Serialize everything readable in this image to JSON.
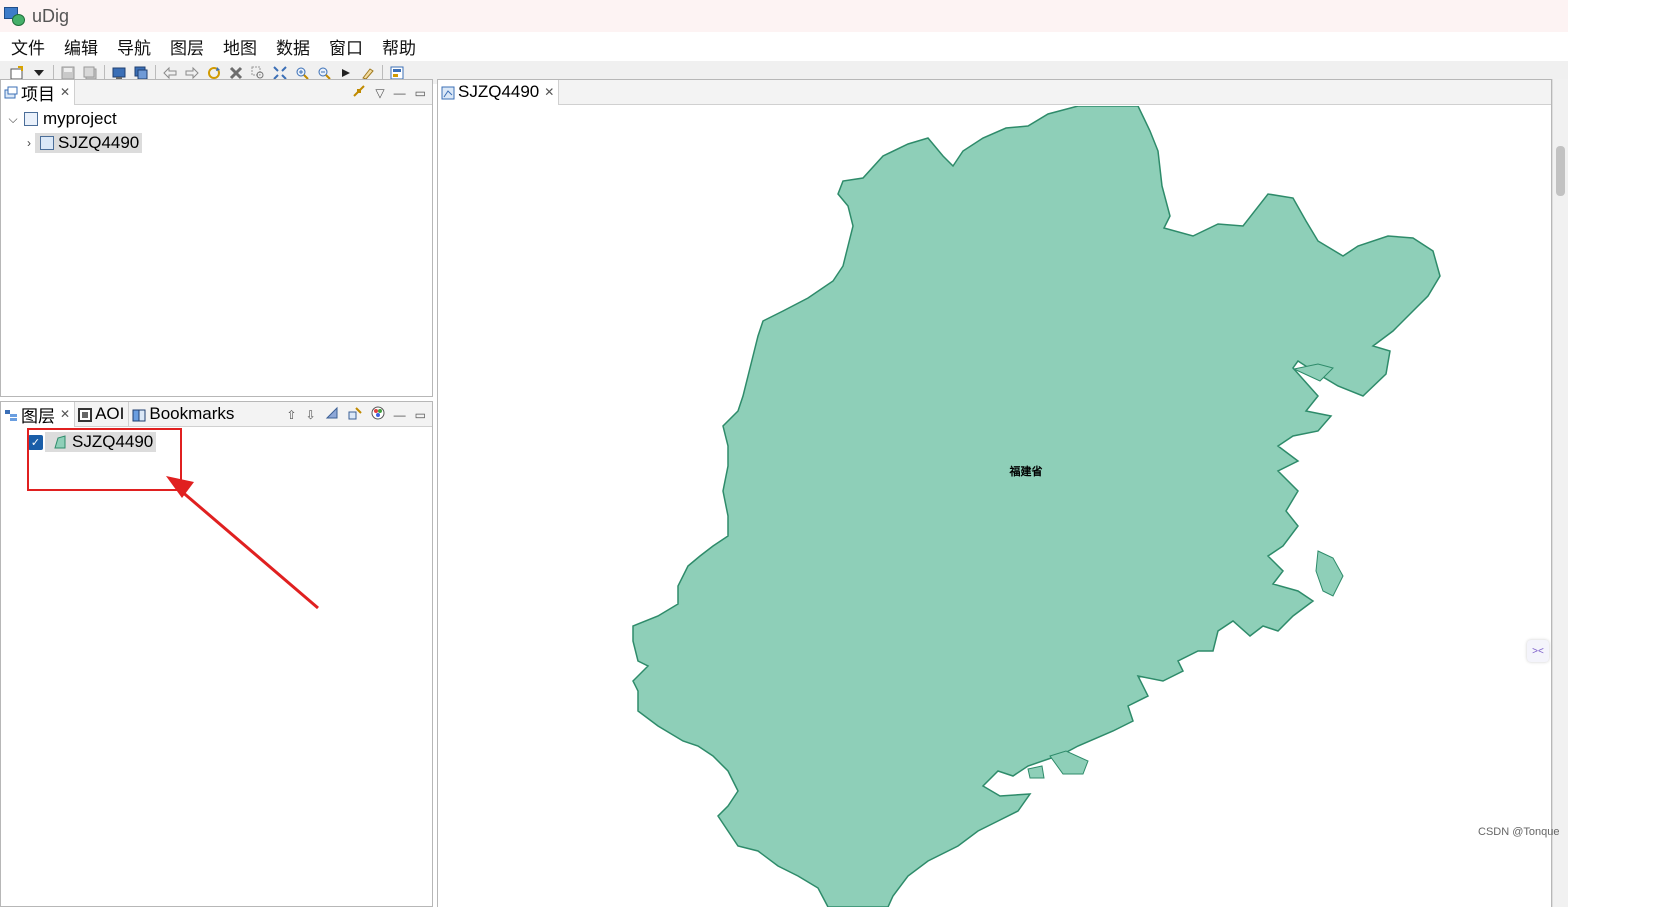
{
  "window": {
    "title": "uDig"
  },
  "menubar": {
    "items": [
      "文件",
      "编辑",
      "导航",
      "图层",
      "地图",
      "数据",
      "窗口",
      "帮助"
    ]
  },
  "toolbar": {
    "icons": [
      "new-icon",
      "dropdown-icon",
      "save-icon",
      "save-all-icon",
      "new-map-icon",
      "new-page-icon",
      "back-icon",
      "forward-icon",
      "refresh-icon",
      "stop-icon",
      "zoom-box-icon",
      "zoom-extent-icon",
      "zoom-in-icon",
      "zoom-out-icon",
      "next-icon",
      "edit-icon",
      "info-icon"
    ]
  },
  "project_panel": {
    "tab_label": "项目",
    "tree": {
      "root_label": "myproject",
      "child_label": "SJZQ4490"
    }
  },
  "layers_panel": {
    "tabs": [
      {
        "label": "图层"
      },
      {
        "label": "AOI"
      },
      {
        "label": "Bookmarks"
      }
    ],
    "layer": {
      "label": "SJZQ4490",
      "checked": true
    }
  },
  "map_panel": {
    "tab_label": "SJZQ4490",
    "map_label": "福建省",
    "fill_color": "#8ecfb8",
    "stroke_color": "#2e8b6a"
  },
  "annotation": {
    "color": "#e02020"
  },
  "watermark": "CSDN @Tonque"
}
